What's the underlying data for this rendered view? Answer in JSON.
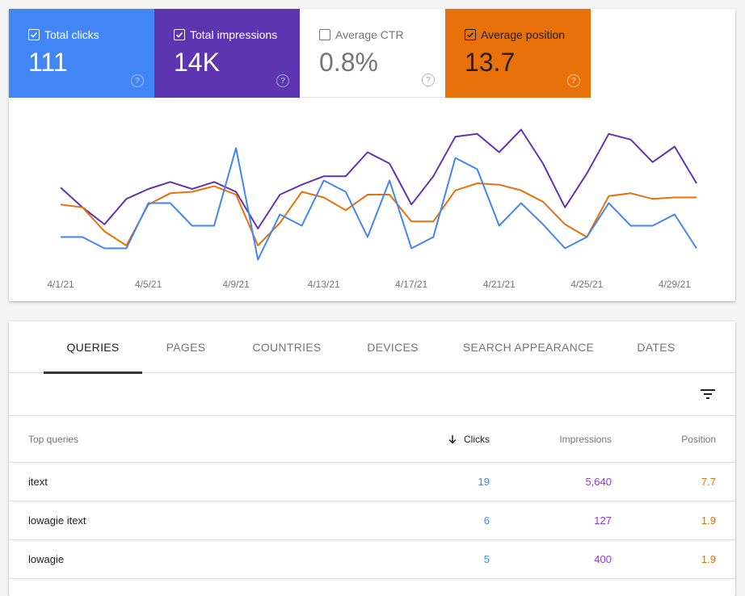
{
  "metrics": [
    {
      "key": "clicks",
      "label": "Total clicks",
      "value": "111",
      "checked": true,
      "color": "#4285f4",
      "help_icon": "help-circle-icon"
    },
    {
      "key": "impressions",
      "label": "Total impressions",
      "value": "14K",
      "checked": true,
      "color": "#5e35b1",
      "help_icon": "help-circle-icon"
    },
    {
      "key": "ctr",
      "label": "Average CTR",
      "value": "0.8%",
      "checked": false,
      "color": "#ffffff",
      "help_icon": "help-circle-icon"
    },
    {
      "key": "position",
      "label": "Average position",
      "value": "13.7",
      "checked": true,
      "color": "#e8710a",
      "help_icon": "help-circle-icon"
    }
  ],
  "help_glyph": "?",
  "chart_data": {
    "type": "line",
    "title": "",
    "xlabel": "",
    "ylabel": "",
    "y_scale": "each series independently normalized (relative level 0-100, no y-axis shown)",
    "ylim": [
      0,
      100
    ],
    "grid": false,
    "legend": "none (metric cards act as legend)",
    "x": [
      "4/1/21",
      "4/2/21",
      "4/3/21",
      "4/4/21",
      "4/5/21",
      "4/6/21",
      "4/7/21",
      "4/8/21",
      "4/9/21",
      "4/10/21",
      "4/11/21",
      "4/12/21",
      "4/13/21",
      "4/14/21",
      "4/15/21",
      "4/16/21",
      "4/17/21",
      "4/18/21",
      "4/19/21",
      "4/20/21",
      "4/21/21",
      "4/22/21",
      "4/23/21",
      "4/24/21",
      "4/25/21",
      "4/26/21",
      "4/27/21",
      "4/28/21",
      "4/29/21",
      "4/30/21"
    ],
    "tick_labels": [
      "4/1/21",
      "4/5/21",
      "4/9/21",
      "4/13/21",
      "4/17/21",
      "4/21/21",
      "4/25/21",
      "4/29/21"
    ],
    "series": [
      {
        "name": "Total impressions",
        "color": "#5e35b1",
        "values": [
          53,
          39,
          27,
          45,
          52,
          57,
          52,
          57,
          50,
          24,
          48,
          55,
          61,
          61,
          78,
          70,
          41,
          61,
          89,
          91,
          78,
          94,
          70,
          39,
          63,
          91,
          87,
          71,
          82,
          56
        ]
      },
      {
        "name": "Average position",
        "color": "#e8710a",
        "values": [
          41,
          39,
          22,
          12,
          41,
          49,
          50,
          54,
          48,
          12,
          28,
          50,
          46,
          37,
          48,
          48,
          29,
          29,
          51,
          56,
          55,
          51,
          43,
          27,
          18,
          47,
          49,
          45,
          46,
          46
        ]
      },
      {
        "name": "Total clicks",
        "color": "#4285f4",
        "values": [
          18,
          18,
          10,
          10,
          42,
          42,
          26,
          26,
          81,
          2,
          34,
          26,
          58,
          50,
          18,
          58,
          10,
          18,
          74,
          66,
          26,
          42,
          27,
          10,
          18,
          42,
          26,
          26,
          34,
          10
        ]
      }
    ]
  },
  "tabs": [
    {
      "label": "QUERIES",
      "active": true
    },
    {
      "label": "PAGES",
      "active": false
    },
    {
      "label": "COUNTRIES",
      "active": false
    },
    {
      "label": "DEVICES",
      "active": false
    },
    {
      "label": "SEARCH APPEARANCE",
      "active": false
    },
    {
      "label": "DATES",
      "active": false
    }
  ],
  "filter_icon": "filter-list-icon",
  "table": {
    "headers": {
      "query": "Top queries",
      "clicks": "Clicks",
      "impressions": "Impressions",
      "position": "Position"
    },
    "sort_icon": "arrow-downward-icon",
    "rows": [
      {
        "query": "itext",
        "clicks": "19",
        "impressions": "5,640",
        "position": "7.7"
      },
      {
        "query": "lowagie itext",
        "clicks": "6",
        "impressions": "127",
        "position": "1.9"
      },
      {
        "query": "lowagie",
        "clicks": "5",
        "impressions": "400",
        "position": "1.9"
      }
    ]
  }
}
